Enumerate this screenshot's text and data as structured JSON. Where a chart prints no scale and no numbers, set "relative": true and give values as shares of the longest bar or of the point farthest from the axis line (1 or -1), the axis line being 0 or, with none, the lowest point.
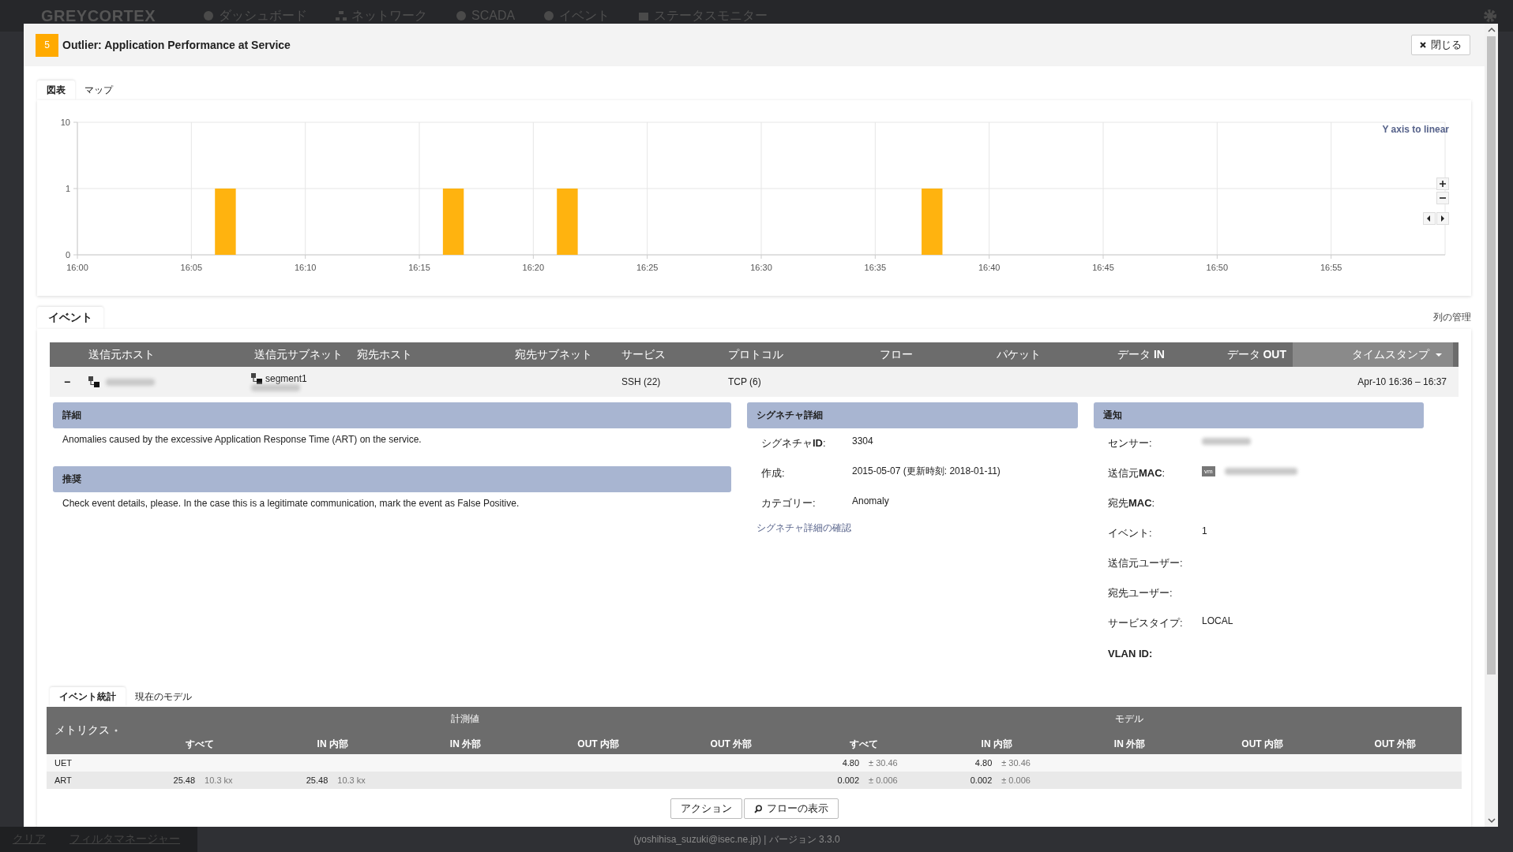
{
  "background_app": {
    "logo": "GREYCORTEX",
    "nav": [
      "ダッシュボード",
      "ネットワーク",
      "SCADA",
      "イベント",
      "ステータスモニター"
    ],
    "footer_links": [
      "クリア",
      "フィルタマネージャー"
    ],
    "footer": "(yoshihisa_suzuki@isec.ne.jp) | バージョン 3.3.0"
  },
  "dialog": {
    "severity": "5",
    "title": "Outlier: Application Performance at Service",
    "close_label": "閉じる"
  },
  "chart_tabs": [
    {
      "label": "図表",
      "selected": true
    },
    {
      "label": "マップ",
      "selected": false
    }
  ],
  "chart": {
    "y_scale_link": "Y axis to linear",
    "y_axis_labels": [
      "10",
      "1",
      "0"
    ],
    "chart_data": {
      "type": "bar",
      "relative": true,
      "grid": true,
      "categories": [
        "16:00",
        null,
        null,
        null,
        null,
        "16:05",
        null,
        null,
        null,
        null,
        "16:10",
        null,
        null,
        null,
        null,
        "16:15",
        null,
        null,
        null,
        null,
        "16:20",
        null,
        null,
        null,
        null,
        "16:25",
        null,
        null,
        null,
        null,
        "16:30",
        null,
        null,
        null,
        null,
        "16:35",
        null,
        null,
        null,
        null,
        "16:40",
        null,
        null,
        null,
        null,
        "16:45",
        null,
        null,
        null,
        null,
        "16:50",
        null,
        null,
        null,
        null,
        "16:55",
        null,
        null,
        null,
        null
      ],
      "values": [
        0,
        0,
        0,
        0,
        0,
        0,
        1,
        0,
        0,
        0,
        0,
        0,
        0,
        0,
        0,
        0,
        1,
        0,
        0,
        0,
        0,
        1,
        0,
        0,
        0,
        0,
        0,
        0,
        0,
        0,
        0,
        0,
        0,
        0,
        0,
        0,
        0,
        1,
        0,
        0,
        0,
        0,
        0,
        0,
        0,
        0,
        0,
        0,
        0,
        0,
        0,
        0,
        0,
        0,
        0,
        0,
        0,
        0,
        0,
        0
      ]
    }
  },
  "events": {
    "tab": "イベント",
    "manage_columns": "列の管理",
    "columns": [
      {
        "label": "送信元ホスト",
        "sorted": false
      },
      {
        "label": "送信元サブネット",
        "sorted": false
      },
      {
        "label": "宛先ホスト",
        "sorted": false
      },
      {
        "label": "宛先サブネット",
        "sorted": false
      },
      {
        "label": "サービス",
        "sorted": false
      },
      {
        "label": "プロトコル",
        "sorted": false
      },
      {
        "label": "フロー",
        "sorted": false
      },
      {
        "label": "パケット",
        "sorted": false
      },
      {
        "label": "データ **IN**",
        "sorted": false
      },
      {
        "label": "データ **OUT**",
        "sorted": false
      },
      {
        "label": "タイムスタンプ",
        "sorted": true
      }
    ],
    "rows": [
      {
        "toggle": "−",
        "expanded": true,
        "subnet": "segment1",
        "service": "SSH (22)",
        "protocol": "TCP (6)",
        "timestamp": "Apr-10 16:36 – 16:37"
      }
    ]
  },
  "details": [
    {
      "title": "詳細",
      "text": "Anomalies caused by the excessive Application Response Time (ART) on the service."
    },
    {
      "title": "推奨",
      "text": "Check event details, please. In the case this is a legitimate communication, mark the event as False Positive."
    }
  ],
  "signature": {
    "title": "シグネチャ詳細",
    "fields": [
      {
        "label": "シグネチャ**ID**:",
        "value": "3304"
      },
      {
        "label": "作成:",
        "value": "2015-05-07 (更新時刻: 2018-01-11)"
      },
      {
        "label": "カテゴリー:",
        "value": "Anomaly"
      }
    ],
    "link": "シグネチャ詳細の確認"
  },
  "notice": {
    "title": "通知",
    "fields": [
      {
        "label": "センサー:",
        "kind": "blurred"
      },
      {
        "label": "送信元**MAC**:",
        "kind": "vm-blurred",
        "badge": "vm"
      },
      {
        "label": "宛先**MAC**:",
        "kind": "text"
      },
      {
        "label": "イベント:",
        "kind": "text",
        "value": "1"
      },
      {
        "label": "送信元ユーザー:",
        "kind": "text"
      },
      {
        "label": "宛先ユーザー:",
        "kind": "text"
      },
      {
        "label": "サービスタイプ:",
        "kind": "text",
        "value": "LOCAL"
      },
      {
        "label": "VLAN ID:",
        "kind": "text",
        "bold": true
      }
    ]
  },
  "stats": {
    "tabs": [
      {
        "label": "イベント統計",
        "selected": true
      },
      {
        "label": "現在のモデル",
        "selected": false
      }
    ],
    "metric_header": "メトリクス",
    "groups": [
      "計測値",
      "モデル"
    ],
    "columns": [
      "すべて",
      "IN 内部",
      "IN 外部",
      "OUT 内部",
      "OUT 外部",
      "すべて",
      "IN 内部",
      "IN 外部",
      "OUT 内部",
      "OUT 外部"
    ],
    "rows": [
      {
        "metric": "UET",
        "cells": [
          null,
          null,
          null,
          null,
          null,
          {
            "value": "4.80",
            "spread": "± 30.46"
          },
          {
            "value": "4.80",
            "spread": "± 30.46"
          },
          null,
          null,
          null
        ]
      },
      {
        "metric": "ART",
        "cells": [
          {
            "value": "25.48",
            "spread": "10.3 kx"
          },
          {
            "value": "25.48",
            "spread": "10.3 kx"
          },
          null,
          null,
          null,
          {
            "value": "0.002",
            "spread": "± 0.006"
          },
          {
            "value": "0.002",
            "spread": "± 0.006"
          },
          null,
          null,
          null
        ]
      }
    ]
  },
  "actions": [
    {
      "label": "アクション",
      "kind": "plain"
    },
    {
      "label": "フローの表示",
      "kind": "search"
    }
  ]
}
